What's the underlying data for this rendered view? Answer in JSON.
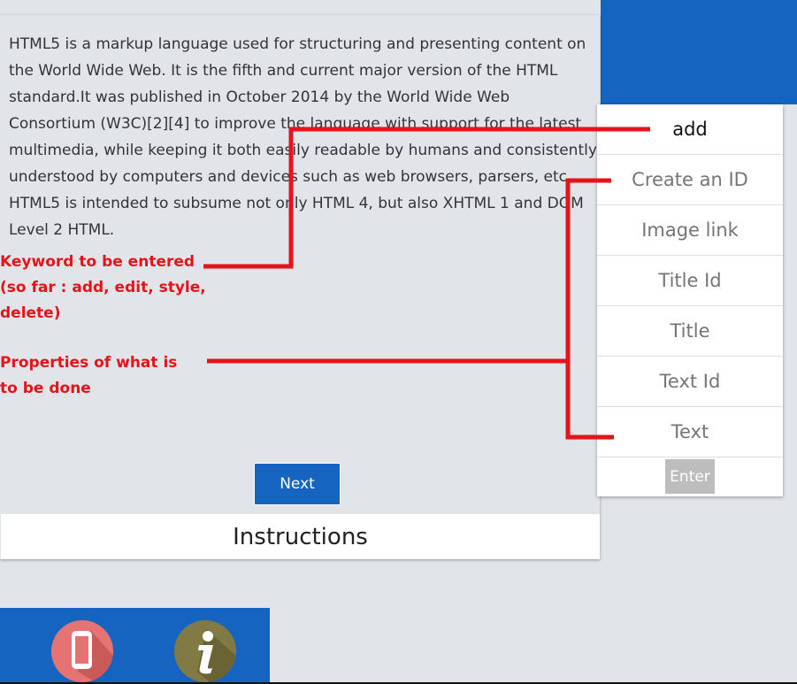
{
  "article": {
    "paragraph": "HTML5 is a markup language used for structuring and presenting content on the World Wide Web. It is the fifth and current major version of the HTML standard.It was published in October 2014 by the World Wide Web Consortium (W3C)[2][4] to improve the language with support for the latest multimedia, while keeping it both easily readable by humans and consistently understood by computers and devices such as web browsers, parsers, etc. HTML5 is intended to subsume not only HTML 4, but also XHTML 1 and DOM Level 2 HTML.",
    "next_label": "Next",
    "footer_title": "Instructions"
  },
  "annotations": {
    "keyword_lines": [
      "Keyword to be entered",
      "(so far : add, edit, style,",
      "delete)"
    ],
    "properties_lines": [
      "Properties of what is",
      "to be done"
    ],
    "color": "#e5131a"
  },
  "command_panel": {
    "keyword_value": "add",
    "fields": [
      {
        "placeholder": "Create an ID"
      },
      {
        "placeholder": "Image link"
      },
      {
        "placeholder": "Title Id"
      },
      {
        "placeholder": "Title"
      },
      {
        "placeholder": "Text Id"
      },
      {
        "placeholder": "Text"
      }
    ],
    "enter_label": "Enter"
  },
  "bottom_bar": {
    "icons": [
      "phone-icon",
      "info-icon"
    ]
  },
  "colors": {
    "accent_blue": "#1565c0",
    "background": "#e1e5ea",
    "phone_icon_bg": "#e57373",
    "info_icon_bg": "#827a45"
  }
}
